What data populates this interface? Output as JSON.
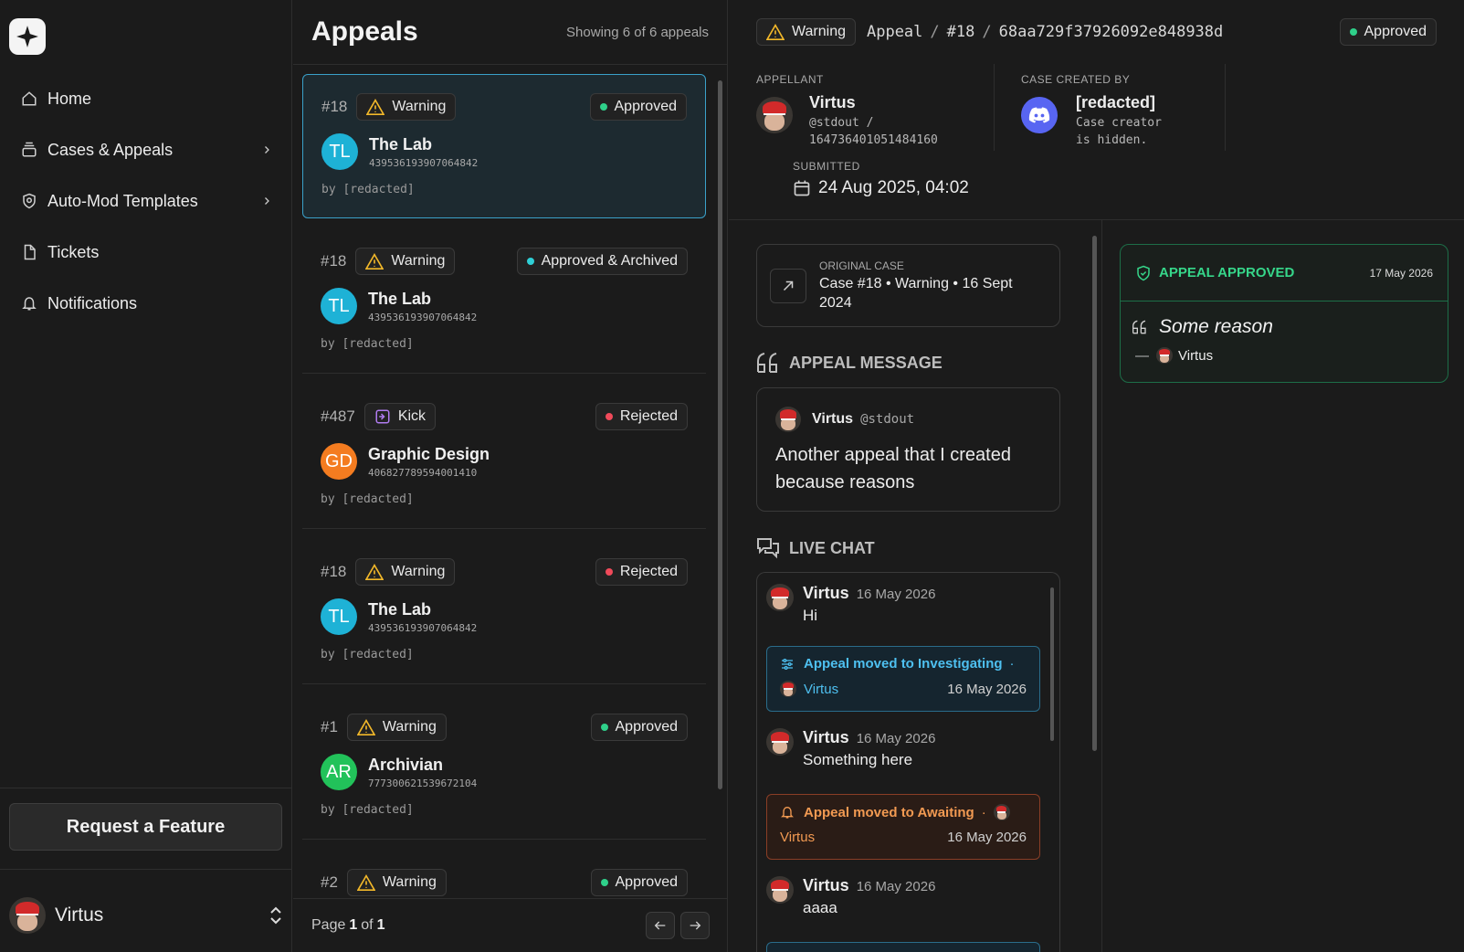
{
  "sidebar": {
    "nav": [
      {
        "label": "Home",
        "icon": "home-icon"
      },
      {
        "label": "Cases & Appeals",
        "icon": "stack-icon"
      },
      {
        "label": "Auto-Mod Templates",
        "icon": "shield-icon"
      },
      {
        "label": "Tickets",
        "icon": "file-icon"
      },
      {
        "label": "Notifications",
        "icon": "bell-icon"
      }
    ],
    "feature_button": "Request a Feature",
    "user": "Virtus"
  },
  "list": {
    "title": "Appeals",
    "count": "Showing 6 of 6 appeals",
    "cards": [
      {
        "num": "#18",
        "type": "Warning",
        "status": "Approved",
        "status_color": "#2fd08a",
        "initials": "TL",
        "avatar_color": "#1eb2d6",
        "name": "The Lab",
        "id": "439536193907064842",
        "by": "by [redacted]"
      },
      {
        "num": "#18",
        "type": "Warning",
        "status": "Approved & Archived",
        "status_color": "#2fcfd6",
        "initials": "TL",
        "avatar_color": "#1eb2d6",
        "name": "The Lab",
        "id": "439536193907064842",
        "by": "by [redacted]"
      },
      {
        "num": "#487",
        "type": "Kick",
        "status": "Rejected",
        "status_color": "#f04a5a",
        "initials": "GD",
        "avatar_color": "#f47c20",
        "name": "Graphic Design",
        "id": "406827789594001410",
        "by": "by [redacted]"
      },
      {
        "num": "#18",
        "type": "Warning",
        "status": "Rejected",
        "status_color": "#f04a5a",
        "initials": "TL",
        "avatar_color": "#1eb2d6",
        "name": "The Lab",
        "id": "439536193907064842",
        "by": "by [redacted]"
      },
      {
        "num": "#1",
        "type": "Warning",
        "status": "Approved",
        "status_color": "#2fd08a",
        "initials": "AR",
        "avatar_color": "#22c25a",
        "name": "Archivian",
        "id": "777300621539672104",
        "by": "by [redacted]"
      },
      {
        "num": "#2",
        "type": "Warning",
        "status": "Approved",
        "status_color": "#2fd08a",
        "initials": "",
        "avatar_color": "#1eb2d6",
        "name": "",
        "id": "",
        "by": ""
      }
    ],
    "pager": {
      "prefix": "Page",
      "page": "1",
      "of": "of",
      "total": "1"
    }
  },
  "detail": {
    "type": "Warning",
    "crumb": {
      "a": "Appeal",
      "sep": "/",
      "b": "#18",
      "c": "68aa729f37926092e848938d"
    },
    "status": "Approved",
    "appellant_label": "APPELLANT",
    "appellant_name": "Virtus",
    "appellant_handle": "@stdout /",
    "appellant_id": "164736401051484160",
    "creator_label": "CASE CREATED BY",
    "creator_name": "[redacted]",
    "creator_sub1": "Case creator",
    "creator_sub2": "is hidden.",
    "submitted_label": "SUBMITTED",
    "submitted_date": "24 Aug 2025, 04:02",
    "original_label": "ORIGINAL CASE",
    "original_text": "Case #18 • Warning • 16 Sept 2024",
    "message_title": "APPEAL MESSAGE",
    "message_author": "Virtus",
    "message_handle": "@stdout",
    "message_text": "Another appeal that I created because reasons",
    "chat_title": "LIVE CHAT",
    "chat": {
      "m1": {
        "name": "Virtus",
        "time": "16 May 2026",
        "text": "Hi"
      },
      "e1": {
        "text": "Appeal moved to Investigating",
        "dot": "·",
        "by": "Virtus",
        "date": "16 May 2026"
      },
      "m2": {
        "name": "Virtus",
        "time": "16 May 2026",
        "text": "Something here"
      },
      "e2": {
        "text": "Appeal moved to Awaiting",
        "dot": "·",
        "by": "Virtus",
        "date": "16 May 2026"
      },
      "m3": {
        "name": "Virtus",
        "time": "16 May 2026",
        "text": "aaaa"
      }
    },
    "approved": {
      "title": "APPEAL APPROVED",
      "date": "17 May 2026",
      "reason": "Some reason",
      "dash": "—",
      "by": "Virtus"
    }
  }
}
